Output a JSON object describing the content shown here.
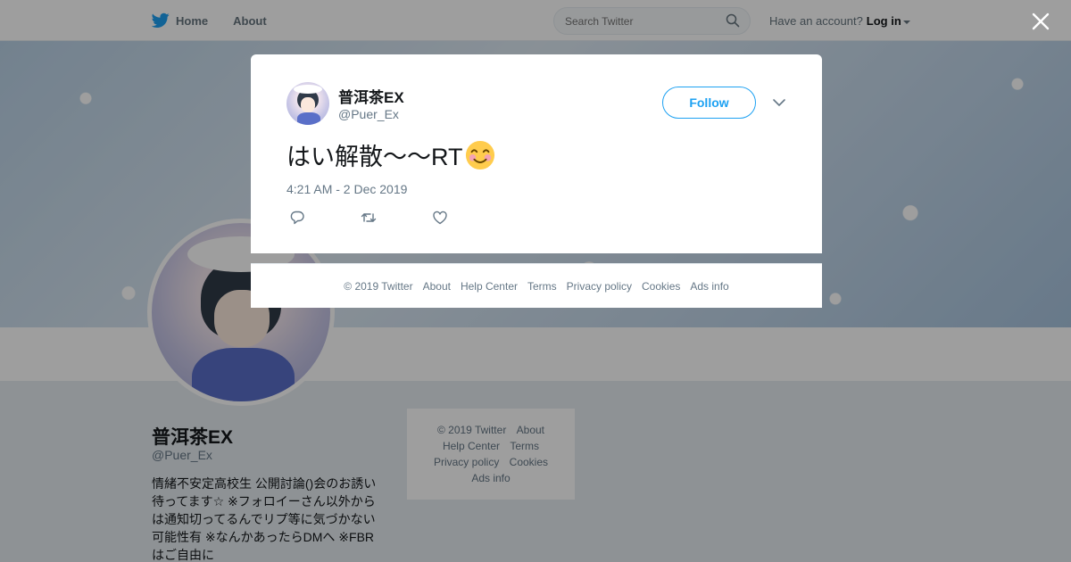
{
  "nav": {
    "home_label": "Home",
    "about_label": "About",
    "search_placeholder": "Search Twitter",
    "have_account": "Have an account?",
    "login_label": "Log in"
  },
  "profile": {
    "name": "普洱茶EX",
    "handle": "@Puer_Ex",
    "bio": "情緒不安定高校生 公開討論()会のお誘い待ってます☆ ※フォロイーさん以外からは通知切ってるんでリプ等に気づかない可能性有 ※なんかあったらDMへ ※FBRはご自由に"
  },
  "side_footer": {
    "items": [
      "© 2019 Twitter",
      "About",
      "Help Center",
      "Terms",
      "Privacy policy",
      "Cookies",
      "Ads info"
    ]
  },
  "tweet": {
    "name": "普洱茶EX",
    "handle": "@Puer_Ex",
    "follow_label": "Follow",
    "text": "はい解散〜〜RT",
    "emoji": "smiling-face-with-smiling-eyes",
    "timestamp": "4:21 AM - 2 Dec 2019"
  },
  "modal_footer": {
    "items": [
      "© 2019 Twitter",
      "About",
      "Help Center",
      "Terms",
      "Privacy policy",
      "Cookies",
      "Ads info"
    ]
  },
  "colors": {
    "brand_blue": "#1da1f2",
    "text_secondary": "#657786",
    "overlay": "rgba(0,0,0,0.38)"
  }
}
